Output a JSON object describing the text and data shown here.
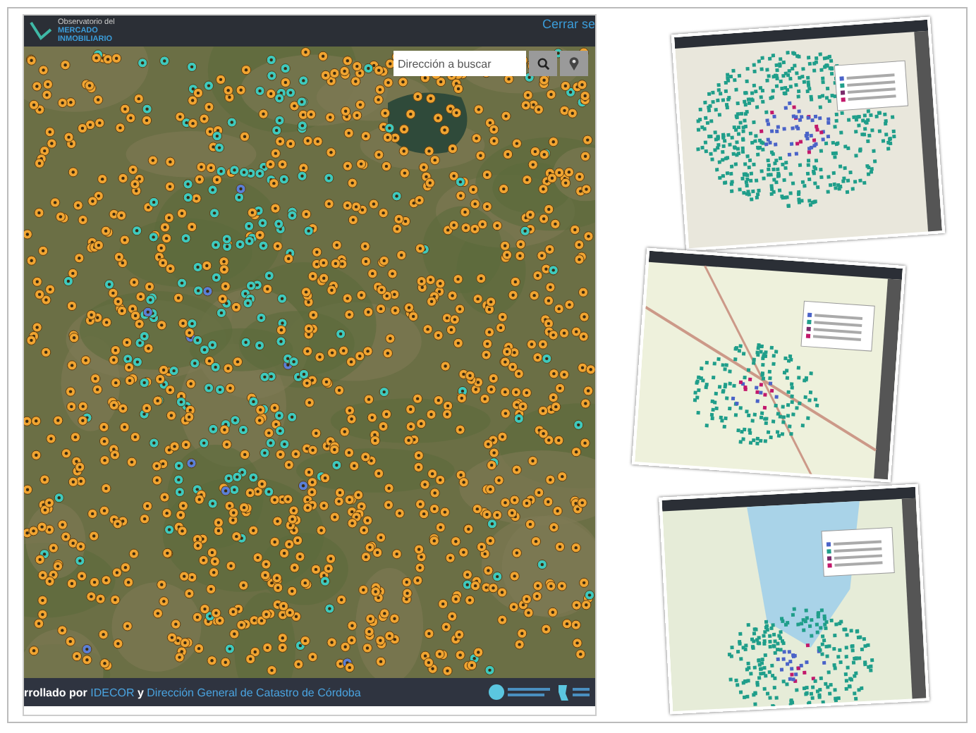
{
  "main_screenshot": {
    "header": {
      "logo_lines": [
        "Observatorio del",
        "MERCADO",
        "INMOBILIARIO"
      ],
      "link": "Cerrar se"
    },
    "search": {
      "placeholder": "Dirección a buscar"
    },
    "footer": {
      "credits": [
        {
          "kind": "plain",
          "text": "rrollado por "
        },
        {
          "kind": "link",
          "text": "IDECOR"
        },
        {
          "kind": "plain",
          "text": " y "
        },
        {
          "kind": "link",
          "text": "Dirección General de Catastro de Córdoba"
        }
      ]
    }
  },
  "thumbnails": [
    {
      "kind": "dense"
    },
    {
      "kind": "sparse"
    },
    {
      "kind": "lake"
    }
  ]
}
